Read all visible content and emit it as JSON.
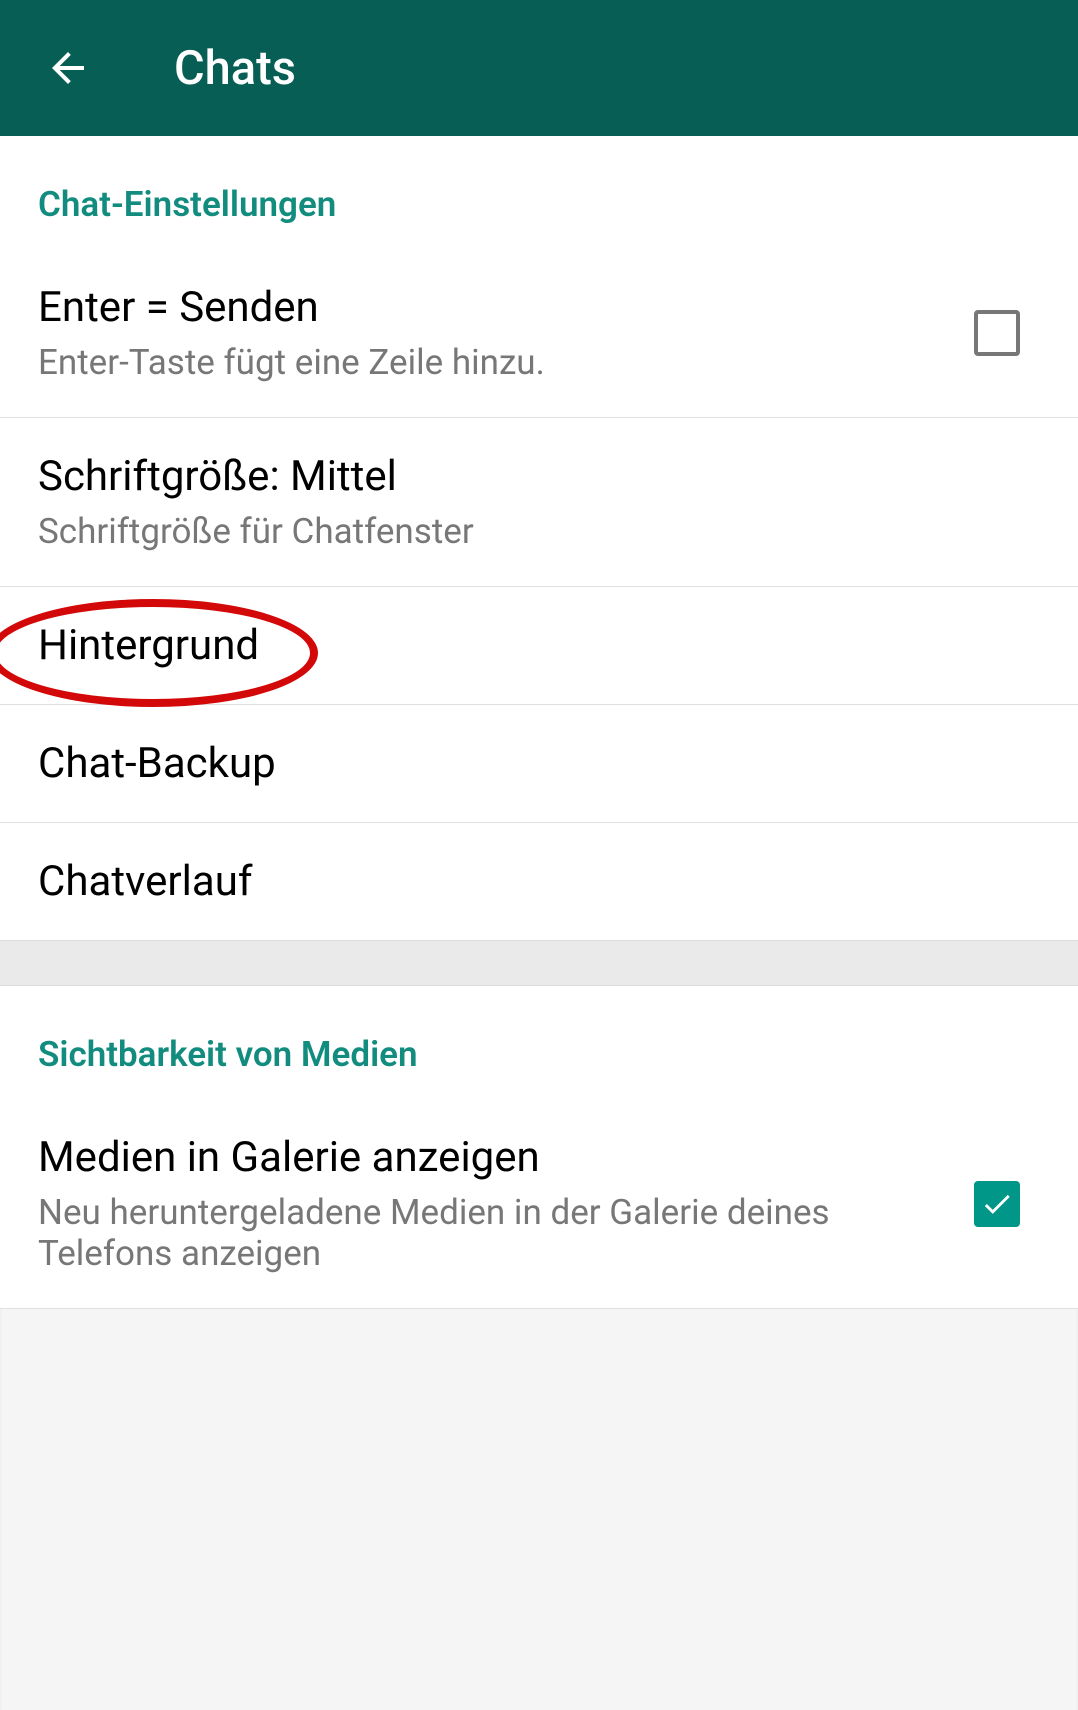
{
  "header": {
    "title": "Chats"
  },
  "sections": {
    "chat_settings": {
      "heading": "Chat-Einstellungen",
      "enter_send": {
        "title": "Enter = Senden",
        "subtitle": "Enter-Taste fügt eine Zeile hinzu.",
        "checked": false
      },
      "font_size": {
        "title": "Schriftgröße: Mittel",
        "subtitle": "Schriftgröße für Chatfenster"
      },
      "wallpaper": {
        "title": "Hintergrund"
      },
      "backup": {
        "title": "Chat-Backup"
      },
      "history": {
        "title": "Chatverlauf"
      }
    },
    "media_visibility": {
      "heading": "Sichtbarkeit von Medien",
      "show_in_gallery": {
        "title": "Medien in Galerie anzeigen",
        "subtitle": "Neu heruntergeladene Medien in der Galerie deines Telefons anzeigen",
        "checked": true
      }
    }
  },
  "annotation": {
    "target": "wallpaper",
    "shape": "ellipse",
    "color": "#d30808"
  }
}
